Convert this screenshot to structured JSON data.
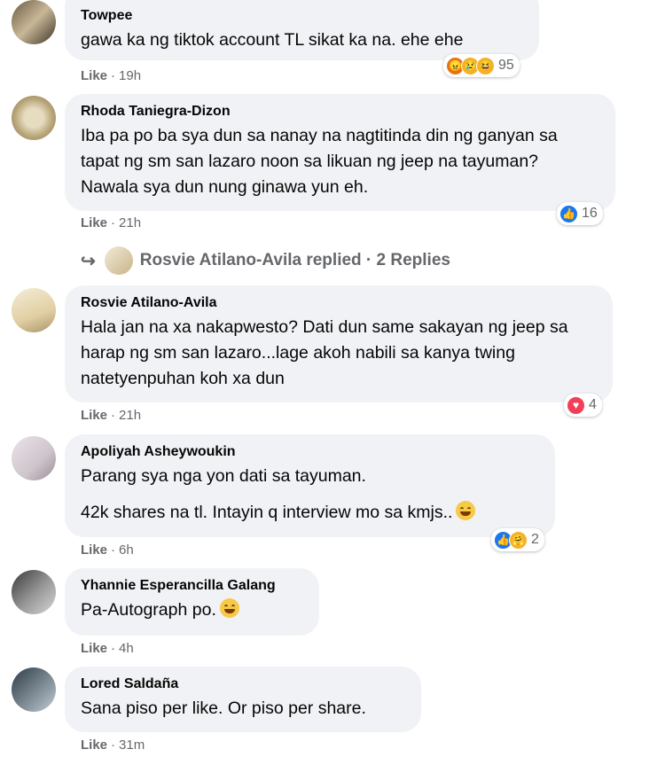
{
  "comments": [
    {
      "author": "Towpee",
      "paragraphs": [
        "gawa ka ng tiktok account TL sikat ka na. ehe ehe"
      ],
      "like": "Like",
      "time": "19h",
      "reactions": {
        "icons": [
          "angry",
          "sad",
          "haha"
        ],
        "count": "95"
      }
    },
    {
      "author": "Rhoda Taniegra-Dizon",
      "paragraphs": [
        "Iba pa po ba sya dun sa nanay na nagtitinda din ng ganyan sa tapat ng sm san lazaro noon sa likuan ng jeep na tayuman? Nawala sya dun nung ginawa yun eh."
      ],
      "like": "Like",
      "time": "21h",
      "reactions": {
        "icons": [
          "like"
        ],
        "count": "16"
      }
    },
    {
      "author": "Rosvie Atilano-Avila",
      "paragraphs": [
        "Hala jan na xa nakapwesto? Dati dun same sakayan ng jeep sa harap ng sm san lazaro...lage akoh nabili sa kanya twing natetyenpuhan koh xa dun"
      ],
      "like": "Like",
      "time": "21h",
      "reactions": {
        "icons": [
          "love"
        ],
        "count": "4"
      }
    },
    {
      "author": "Apoliyah Asheywoukin",
      "paragraphs": [
        "Parang sya nga yon dati sa tayuman.",
        "42k shares na tl. Intayin q interview mo sa kmjs.."
      ],
      "like": "Like",
      "time": "6h",
      "reactions": {
        "icons": [
          "like",
          "care"
        ],
        "count": "2"
      }
    },
    {
      "author": "Yhannie Esperancilla Galang",
      "paragraphs": [
        "Pa-Autograph po."
      ],
      "like": "Like",
      "time": "4h"
    },
    {
      "author": "Lored Saldaña",
      "paragraphs": [
        "Sana piso per like. Or piso per share."
      ],
      "like": "Like",
      "time": "31m"
    }
  ],
  "replies": {
    "text": "Rosvie Atilano-Avila replied · 2 Replies"
  },
  "separator": "·",
  "colors": {
    "like_blue": "#1877f2",
    "love_red": "#f33e58",
    "bubble": "#f0f2f5",
    "meta": "#65676b"
  }
}
